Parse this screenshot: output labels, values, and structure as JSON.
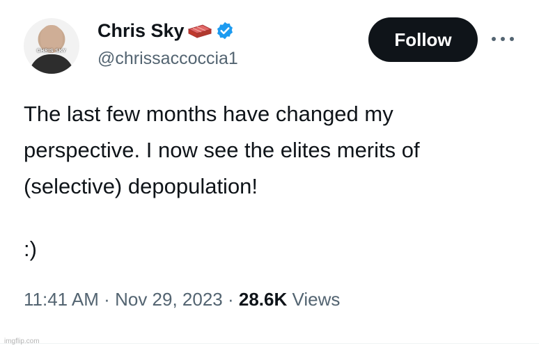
{
  "author": {
    "display_name": "Chris Sky",
    "handle": "@chrissaccoccia1",
    "avatar_caption": "CHRIS SKY",
    "name_emoji": "brick-icon",
    "verified_color": "#1d9bf0"
  },
  "actions": {
    "follow_label": "Follow",
    "more_icon": "more-dots-icon"
  },
  "tweet": {
    "lines": [
      "The last few months have changed my",
      "perspective. I now see the elites merits of",
      "(selective) depopulation!"
    ],
    "smile": ":)"
  },
  "meta": {
    "time": "11:41 AM",
    "separator": "·",
    "date": "Nov 29, 2023",
    "views_count": "28.6K",
    "views_label": "Views"
  },
  "watermark": "imgflip.com"
}
